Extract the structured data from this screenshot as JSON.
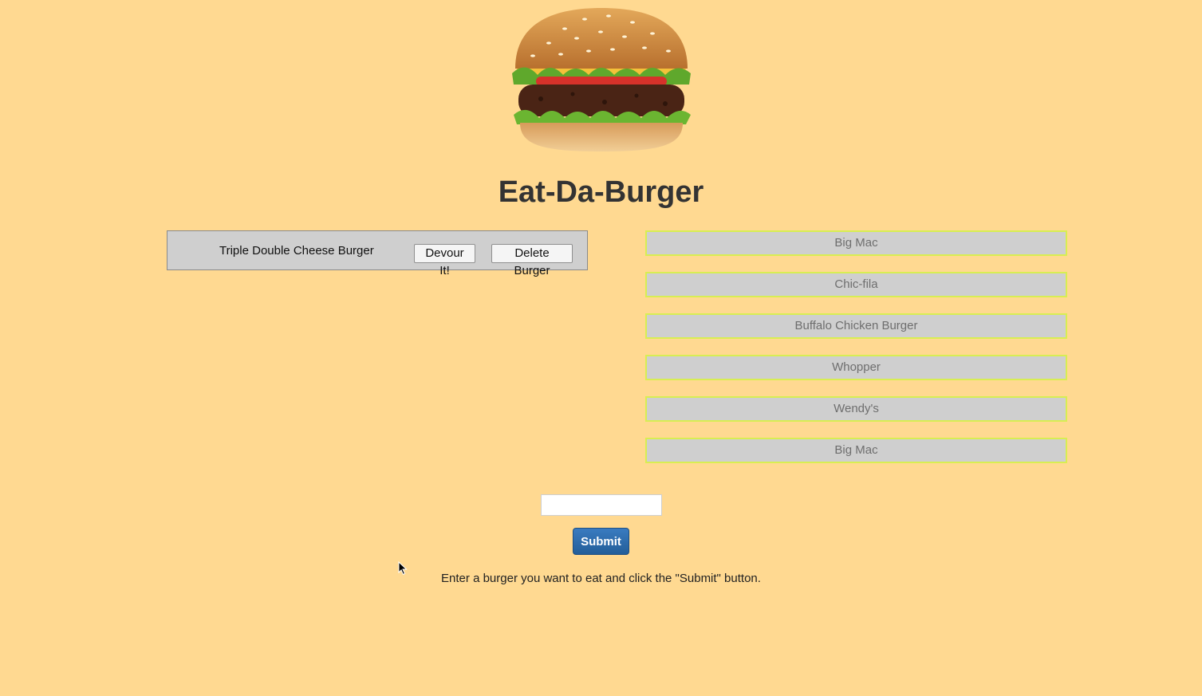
{
  "page": {
    "title": "Eat-Da-Burger",
    "instructions": "Enter a burger you want to eat and click the \"Submit\" button."
  },
  "uneaten": [
    {
      "name": "Triple Double Cheese Burger",
      "devour_label": "Devour It!",
      "delete_label": "Delete Burger"
    }
  ],
  "eaten": [
    {
      "name": "Big Mac"
    },
    {
      "name": "Chic-fila"
    },
    {
      "name": "Buffalo Chicken Burger"
    },
    {
      "name": "Whopper"
    },
    {
      "name": "Wendy's"
    },
    {
      "name": "Big Mac"
    }
  ],
  "form": {
    "input_value": "",
    "input_placeholder": "",
    "submit_label": "Submit"
  },
  "icons": {
    "hero": "burger-image",
    "cursor": "mouse-pointer-icon"
  },
  "colors": {
    "background": "#FFD991",
    "card_background": "#CFCFCF",
    "eaten_border": "#D8EE52",
    "submit_button": "#2B6BAE"
  }
}
